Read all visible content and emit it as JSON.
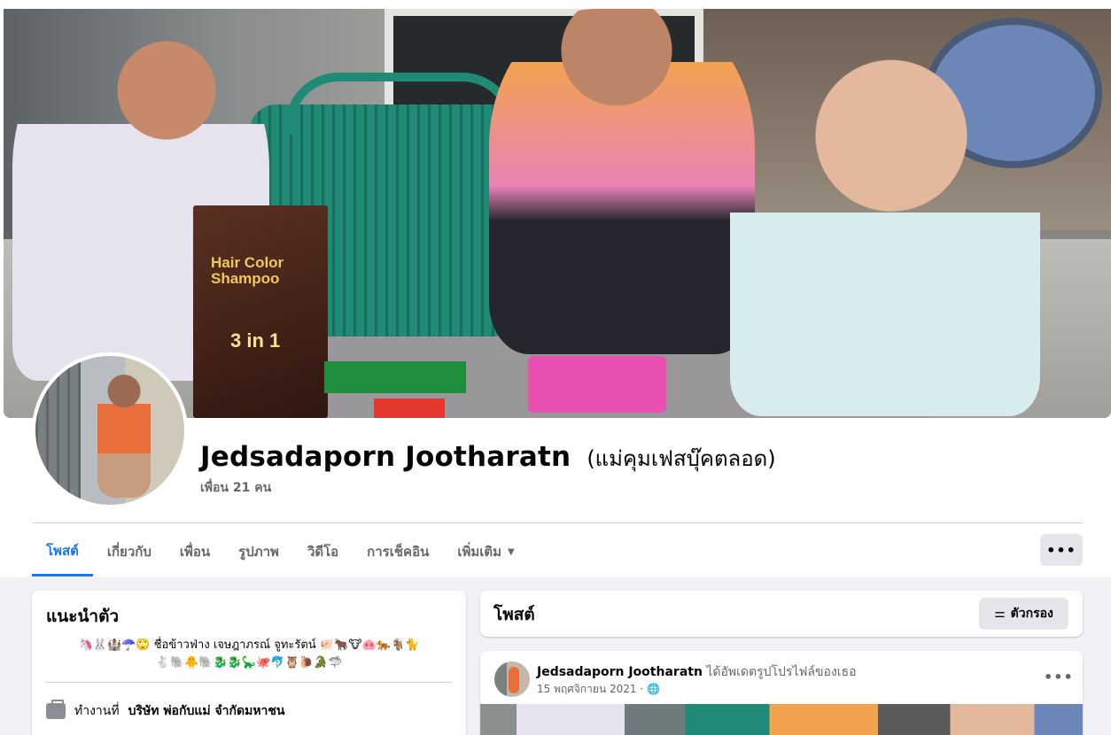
{
  "cover": {
    "product_title": "Hair Color Shampoo",
    "product_badge": "3 in 1"
  },
  "profile": {
    "name": "Jedsadaporn Jootharatn",
    "alternate_name": "(แม่คุมเฟสบุ๊คตลอด)",
    "friends": "เพื่อน 21 คน"
  },
  "tabs": [
    {
      "label": "โพสต์",
      "active": true
    },
    {
      "label": "เกี่ยวกับ"
    },
    {
      "label": "เพื่อน"
    },
    {
      "label": "รูปภาพ"
    },
    {
      "label": "วิดีโอ"
    },
    {
      "label": "การเช็คอิน"
    },
    {
      "label": "เพิ่มเติม"
    }
  ],
  "more_button": "•••",
  "intro": {
    "title": "แนะนำตัว",
    "bio_line1": "🦄🐰🏰☂️🙄 ชื่อข้าวฟ่าง เจษฎาภรณ์ จูทะรัตน์ 🐖🐂🐮🐽🐅🐐🐈",
    "bio_line2": "🐇🐘🐥🐘🐉🐉🦕🐙🐬🦉🐌🐊🦈",
    "work_prefix": "ทำงานที่",
    "work_place": "บริษัท พ่อกับแม่ จำกัดมหาชน"
  },
  "posts": {
    "title": "โพสต์",
    "filter_label": "ตัวกรอง"
  },
  "post": {
    "author": "Jedsadaporn Jootharatn",
    "action": "ได้อัพเดตรูปโปรไฟล์ของเธอ",
    "date": "15 พฤศจิกายน 2021",
    "dots": "•••"
  },
  "colors": {
    "accent": "#1877f2",
    "page_bg": "#f0f2f5",
    "secondary_text": "#65676b"
  }
}
